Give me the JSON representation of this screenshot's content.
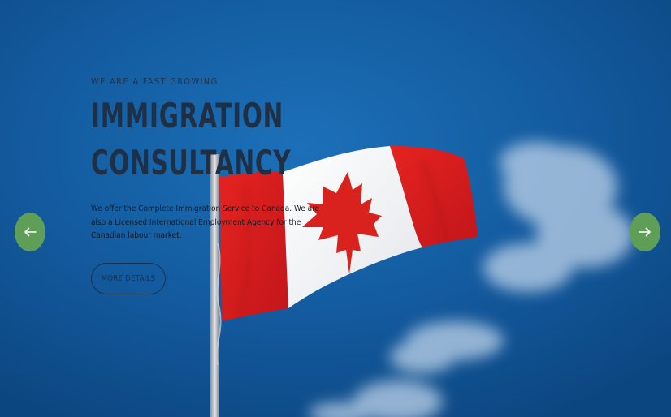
{
  "hero": {
    "eyebrow": "WE ARE A FAST GROWING",
    "headline_line1": "IMMIGRATION",
    "headline_line2": "CONSULTANCY",
    "description": "We offer the Complete Immigration Service to Canada. We are also a Licensed International Employment Agency for the Canadian labour market.",
    "cta_label": "MORE DETAILS"
  },
  "slider": {
    "prev_icon": "arrow-left-icon",
    "next_icon": "arrow-right-icon",
    "arrow_color": "#5e9e57"
  },
  "colors": {
    "sky": "#135a9e",
    "headline": "#1f2f44",
    "flag_red": "#e0201f",
    "flag_white": "#f4f4f4"
  }
}
